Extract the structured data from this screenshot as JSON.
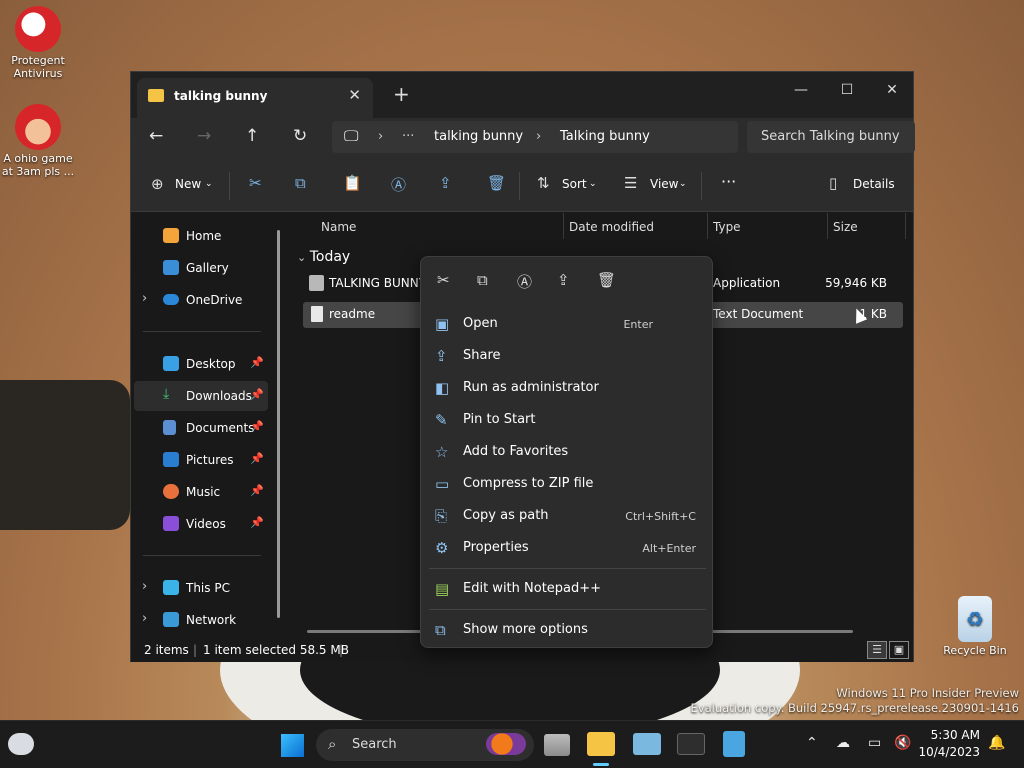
{
  "desktop": {
    "icons": [
      {
        "label": "Protegent Antivirus"
      },
      {
        "label": "A ohio game at 3am pls ..."
      },
      {
        "label": "Recycle Bin"
      }
    ],
    "watermark_line1": "Windows 11 Pro Insider Preview",
    "watermark_line2": "Evaluation copy. Build 25947.rs_prerelease.230901-1416"
  },
  "window": {
    "tab_title": "talking bunny",
    "breadcrumb": [
      "talking bunny",
      "Talking bunny"
    ],
    "search_placeholder": "Search Talking bunny",
    "toolbar": {
      "new_label": "New",
      "sort_label": "Sort",
      "view_label": "View",
      "details_label": "Details"
    },
    "nav": {
      "items": [
        {
          "label": "Home"
        },
        {
          "label": "Gallery"
        },
        {
          "label": "OneDrive"
        },
        {
          "label": "Desktop"
        },
        {
          "label": "Downloads"
        },
        {
          "label": "Documents"
        },
        {
          "label": "Pictures"
        },
        {
          "label": "Music"
        },
        {
          "label": "Videos"
        },
        {
          "label": "This PC"
        },
        {
          "label": "Network"
        }
      ]
    },
    "columns": [
      "Name",
      "Date modified",
      "Type",
      "Size"
    ],
    "group_label": "Today",
    "rows": [
      {
        "name": "TALKING BUNNY",
        "type": "Application",
        "size": "59,946 KB"
      },
      {
        "name": "readme",
        "type": "Text Document",
        "size": "1 KB"
      }
    ],
    "status": {
      "count": "2 items",
      "selection": "1 item selected  58.5 MB"
    }
  },
  "context_menu": {
    "items": [
      {
        "label": "Open",
        "shortcut": "Enter"
      },
      {
        "label": "Share",
        "shortcut": ""
      },
      {
        "label": "Run as administrator",
        "shortcut": ""
      },
      {
        "label": "Pin to Start",
        "shortcut": ""
      },
      {
        "label": "Add to Favorites",
        "shortcut": ""
      },
      {
        "label": "Compress to ZIP file",
        "shortcut": ""
      },
      {
        "label": "Copy as path",
        "shortcut": "Ctrl+Shift+C"
      },
      {
        "label": "Properties",
        "shortcut": "Alt+Enter"
      },
      {
        "label": "Edit with Notepad++",
        "shortcut": ""
      },
      {
        "label": "Show more options",
        "shortcut": ""
      }
    ]
  },
  "taskbar": {
    "search_label": "Search",
    "time": "5:30 AM",
    "date": "10/4/2023"
  },
  "colors": {
    "accent": "#60cdff",
    "folder": "#f5c445",
    "window_bg": "#191919"
  }
}
